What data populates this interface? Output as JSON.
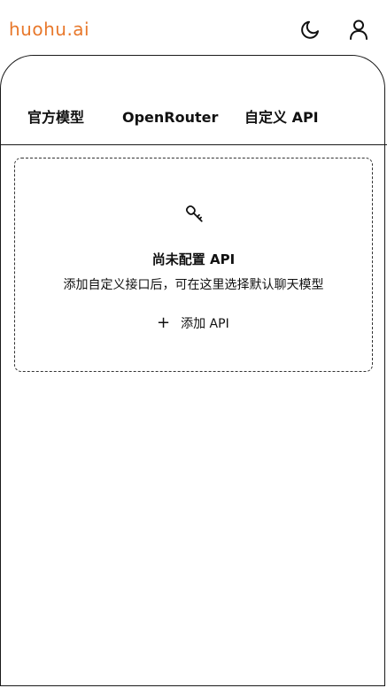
{
  "header": {
    "logo_text": "huohu.ai",
    "logo_color": "#E8782B",
    "theme_toggle_icon": "moon-icon",
    "account_icon": "user-icon"
  },
  "tabs": [
    {
      "label": "官方模型"
    },
    {
      "label": "OpenRouter"
    },
    {
      "label": "自定义 API"
    }
  ],
  "empty_state": {
    "icon": "key-icon",
    "title": "尚未配置 API",
    "description": "添加自定义接口后，可在这里选择默认聊天模型",
    "add_button_label": "添加 API",
    "add_button_icon": "plus-icon"
  }
}
